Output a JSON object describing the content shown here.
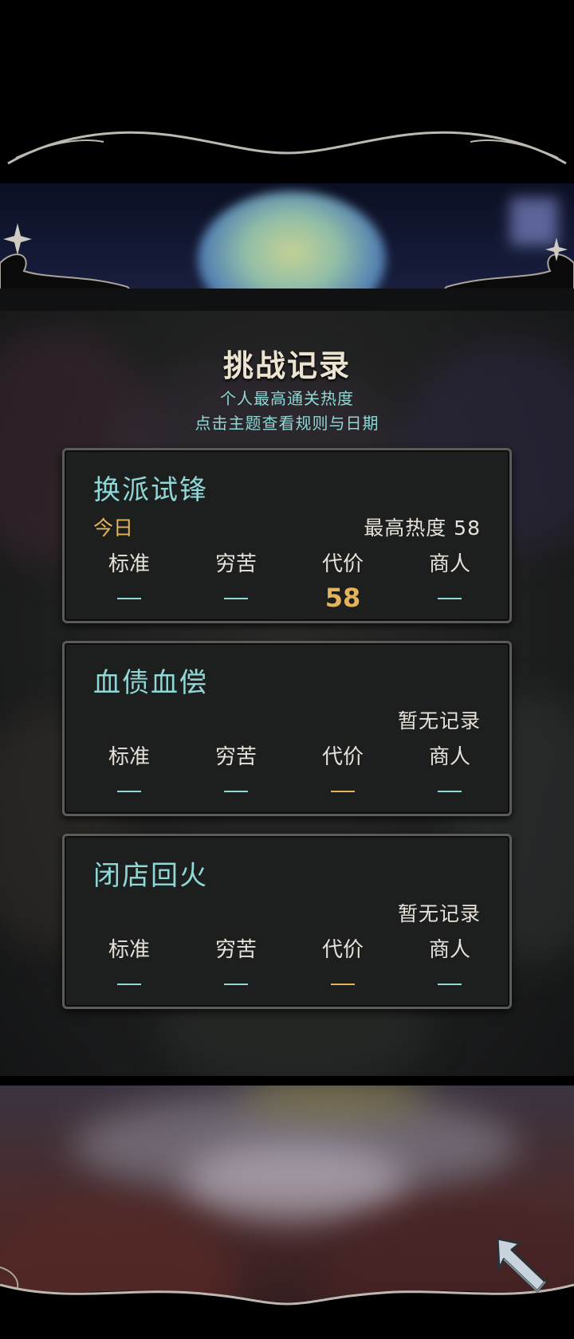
{
  "screen": {
    "title": "挑战记录",
    "subtitle_line1": "个人最高通关热度",
    "subtitle_line2": "点击主题查看规则与日期"
  },
  "colors": {
    "accent_teal": "#8fd8d6",
    "accent_gold": "#e4b35a",
    "text_light": "#e6e2da",
    "card_bg": "#1d1e1e",
    "card_border": "#5b5b58"
  },
  "cards": [
    {
      "name": "换派试锋",
      "tag": "今日",
      "status": "最高热度  58",
      "columns": [
        {
          "label": "标准",
          "value": "",
          "display": "dash",
          "color": "teal"
        },
        {
          "label": "穷苦",
          "value": "",
          "display": "dash",
          "color": "teal"
        },
        {
          "label": "代价",
          "value": "58",
          "display": "number",
          "color": "gold"
        },
        {
          "label": "商人",
          "value": "",
          "display": "dash",
          "color": "teal"
        }
      ]
    },
    {
      "name": "血债血偿",
      "tag": "",
      "status": "暂无记录",
      "columns": [
        {
          "label": "标准",
          "value": "",
          "display": "dash",
          "color": "teal"
        },
        {
          "label": "穷苦",
          "value": "",
          "display": "dash",
          "color": "teal"
        },
        {
          "label": "代价",
          "value": "",
          "display": "dash",
          "color": "gold"
        },
        {
          "label": "商人",
          "value": "",
          "display": "dash",
          "color": "teal"
        }
      ]
    },
    {
      "name": "闭店回火",
      "tag": "",
      "status": "暂无记录",
      "columns": [
        {
          "label": "标准",
          "value": "",
          "display": "dash",
          "color": "teal"
        },
        {
          "label": "穷苦",
          "value": "",
          "display": "dash",
          "color": "teal"
        },
        {
          "label": "代价",
          "value": "",
          "display": "dash",
          "color": "gold"
        },
        {
          "label": "商人",
          "value": "",
          "display": "dash",
          "color": "teal"
        }
      ]
    }
  ],
  "back_button": {
    "icon": "back-arrow-icon"
  }
}
